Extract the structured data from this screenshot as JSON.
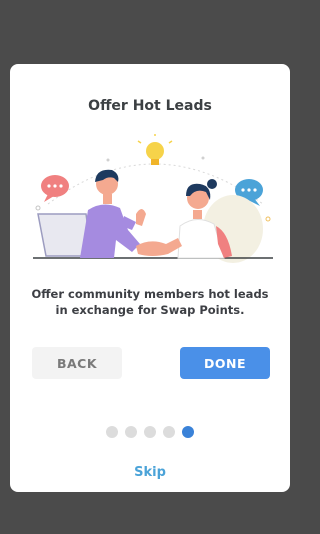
{
  "modal": {
    "title": "Offer Hot Leads",
    "description": "Offer community members hot leads in exchange for Swap Points.",
    "illustration": {
      "icons": [
        "lightbulb-icon",
        "chat-bubble-icon",
        "chat-bubble-icon",
        "handshake-illustration"
      ],
      "colors": {
        "left_bubble": "#f08080",
        "right_bubble": "#4ba3d8",
        "left_person_shirt": "#a58be0",
        "right_person_shirt": "#ffffff",
        "bulb": "#f6d34a",
        "skin": "#f4a990"
      }
    }
  },
  "buttons": {
    "back_label": "BACK",
    "done_label": "DONE"
  },
  "pagination": {
    "total": 5,
    "active_index": 4
  },
  "skip_label": "Skip",
  "colors": {
    "overlay": "#4b4b4b",
    "primary": "#4a90e8",
    "skip": "#4ba3d8",
    "active_dot": "#3a82d8"
  }
}
